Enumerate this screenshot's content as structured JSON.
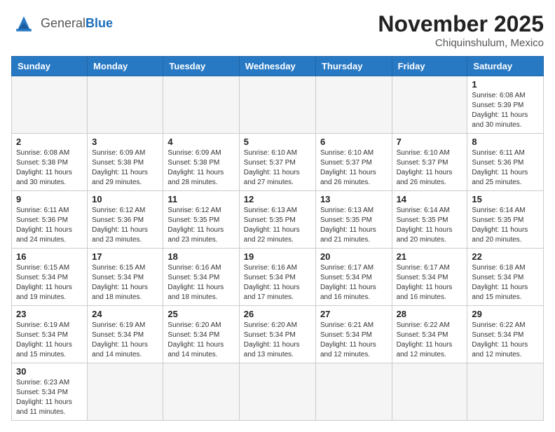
{
  "logo": {
    "general": "General",
    "blue": "Blue"
  },
  "title": "November 2025",
  "location": "Chiquinshulum, Mexico",
  "days_of_week": [
    "Sunday",
    "Monday",
    "Tuesday",
    "Wednesday",
    "Thursday",
    "Friday",
    "Saturday"
  ],
  "weeks": [
    [
      {
        "day": null
      },
      {
        "day": null
      },
      {
        "day": null
      },
      {
        "day": null
      },
      {
        "day": null
      },
      {
        "day": null
      },
      {
        "day": 1,
        "sunrise": "6:08 AM",
        "sunset": "5:39 PM",
        "daylight": "11 hours and 30 minutes."
      }
    ],
    [
      {
        "day": 2,
        "sunrise": "6:08 AM",
        "sunset": "5:38 PM",
        "daylight": "11 hours and 30 minutes."
      },
      {
        "day": 3,
        "sunrise": "6:09 AM",
        "sunset": "5:38 PM",
        "daylight": "11 hours and 29 minutes."
      },
      {
        "day": 4,
        "sunrise": "6:09 AM",
        "sunset": "5:38 PM",
        "daylight": "11 hours and 28 minutes."
      },
      {
        "day": 5,
        "sunrise": "6:10 AM",
        "sunset": "5:37 PM",
        "daylight": "11 hours and 27 minutes."
      },
      {
        "day": 6,
        "sunrise": "6:10 AM",
        "sunset": "5:37 PM",
        "daylight": "11 hours and 26 minutes."
      },
      {
        "day": 7,
        "sunrise": "6:10 AM",
        "sunset": "5:37 PM",
        "daylight": "11 hours and 26 minutes."
      },
      {
        "day": 8,
        "sunrise": "6:11 AM",
        "sunset": "5:36 PM",
        "daylight": "11 hours and 25 minutes."
      }
    ],
    [
      {
        "day": 9,
        "sunrise": "6:11 AM",
        "sunset": "5:36 PM",
        "daylight": "11 hours and 24 minutes."
      },
      {
        "day": 10,
        "sunrise": "6:12 AM",
        "sunset": "5:36 PM",
        "daylight": "11 hours and 23 minutes."
      },
      {
        "day": 11,
        "sunrise": "6:12 AM",
        "sunset": "5:35 PM",
        "daylight": "11 hours and 23 minutes."
      },
      {
        "day": 12,
        "sunrise": "6:13 AM",
        "sunset": "5:35 PM",
        "daylight": "11 hours and 22 minutes."
      },
      {
        "day": 13,
        "sunrise": "6:13 AM",
        "sunset": "5:35 PM",
        "daylight": "11 hours and 21 minutes."
      },
      {
        "day": 14,
        "sunrise": "6:14 AM",
        "sunset": "5:35 PM",
        "daylight": "11 hours and 20 minutes."
      },
      {
        "day": 15,
        "sunrise": "6:14 AM",
        "sunset": "5:35 PM",
        "daylight": "11 hours and 20 minutes."
      }
    ],
    [
      {
        "day": 16,
        "sunrise": "6:15 AM",
        "sunset": "5:34 PM",
        "daylight": "11 hours and 19 minutes."
      },
      {
        "day": 17,
        "sunrise": "6:15 AM",
        "sunset": "5:34 PM",
        "daylight": "11 hours and 18 minutes."
      },
      {
        "day": 18,
        "sunrise": "6:16 AM",
        "sunset": "5:34 PM",
        "daylight": "11 hours and 18 minutes."
      },
      {
        "day": 19,
        "sunrise": "6:16 AM",
        "sunset": "5:34 PM",
        "daylight": "11 hours and 17 minutes."
      },
      {
        "day": 20,
        "sunrise": "6:17 AM",
        "sunset": "5:34 PM",
        "daylight": "11 hours and 16 minutes."
      },
      {
        "day": 21,
        "sunrise": "6:17 AM",
        "sunset": "5:34 PM",
        "daylight": "11 hours and 16 minutes."
      },
      {
        "day": 22,
        "sunrise": "6:18 AM",
        "sunset": "5:34 PM",
        "daylight": "11 hours and 15 minutes."
      }
    ],
    [
      {
        "day": 23,
        "sunrise": "6:19 AM",
        "sunset": "5:34 PM",
        "daylight": "11 hours and 15 minutes."
      },
      {
        "day": 24,
        "sunrise": "6:19 AM",
        "sunset": "5:34 PM",
        "daylight": "11 hours and 14 minutes."
      },
      {
        "day": 25,
        "sunrise": "6:20 AM",
        "sunset": "5:34 PM",
        "daylight": "11 hours and 14 minutes."
      },
      {
        "day": 26,
        "sunrise": "6:20 AM",
        "sunset": "5:34 PM",
        "daylight": "11 hours and 13 minutes."
      },
      {
        "day": 27,
        "sunrise": "6:21 AM",
        "sunset": "5:34 PM",
        "daylight": "11 hours and 12 minutes."
      },
      {
        "day": 28,
        "sunrise": "6:22 AM",
        "sunset": "5:34 PM",
        "daylight": "11 hours and 12 minutes."
      },
      {
        "day": 29,
        "sunrise": "6:22 AM",
        "sunset": "5:34 PM",
        "daylight": "11 hours and 12 minutes."
      }
    ],
    [
      {
        "day": 30,
        "sunrise": "6:23 AM",
        "sunset": "5:34 PM",
        "daylight": "11 hours and 11 minutes."
      },
      {
        "day": null
      },
      {
        "day": null
      },
      {
        "day": null
      },
      {
        "day": null
      },
      {
        "day": null
      },
      {
        "day": null
      }
    ]
  ],
  "labels": {
    "sunrise": "Sunrise:",
    "sunset": "Sunset:",
    "daylight": "Daylight:"
  }
}
